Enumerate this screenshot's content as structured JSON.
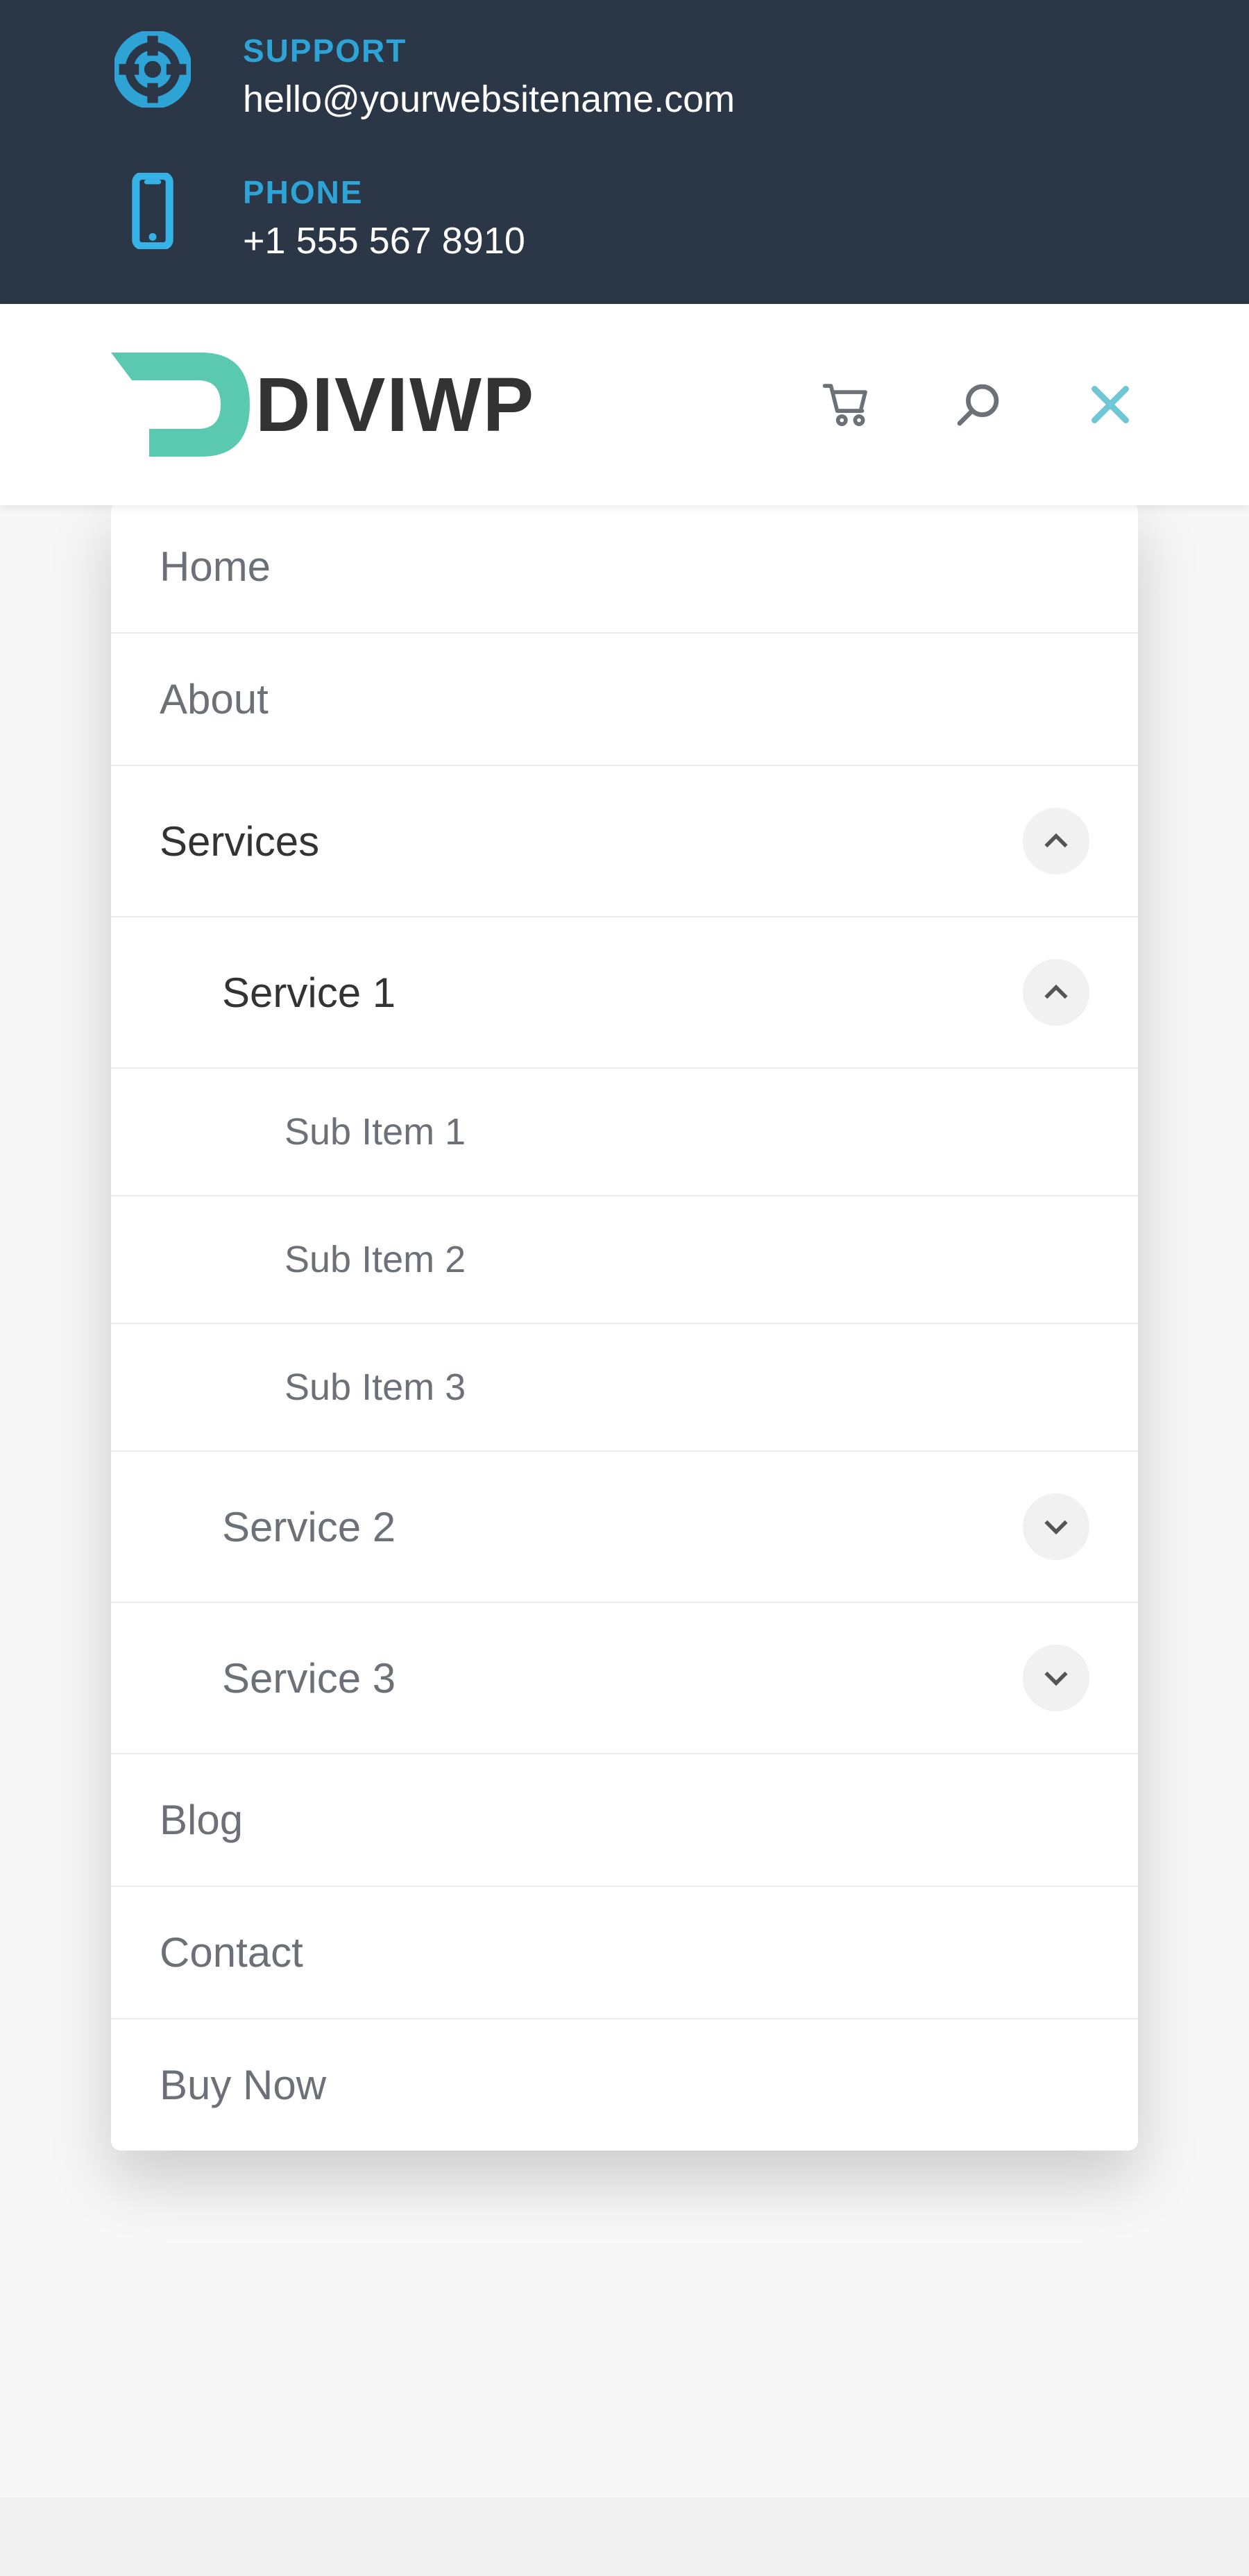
{
  "topbar": {
    "support": {
      "label": "SUPPORT",
      "value": "hello@yourwebsitename.com"
    },
    "phone": {
      "label": "PHONE",
      "value": "+1 555 567 8910"
    }
  },
  "logo": {
    "name": "DIVI",
    "suffix": "WP"
  },
  "icons": {
    "cart": "cart-icon",
    "search": "search-icon",
    "close": "close-icon"
  },
  "menu": {
    "home": "Home",
    "about": "About",
    "services": "Services",
    "service1": "Service 1",
    "sub1": "Sub Item 1",
    "sub2": "Sub Item 2",
    "sub3": "Sub Item 3",
    "service2": "Service 2",
    "service3": "Service 3",
    "blog": "Blog",
    "contact": "Contact",
    "buy": "Buy Now"
  }
}
